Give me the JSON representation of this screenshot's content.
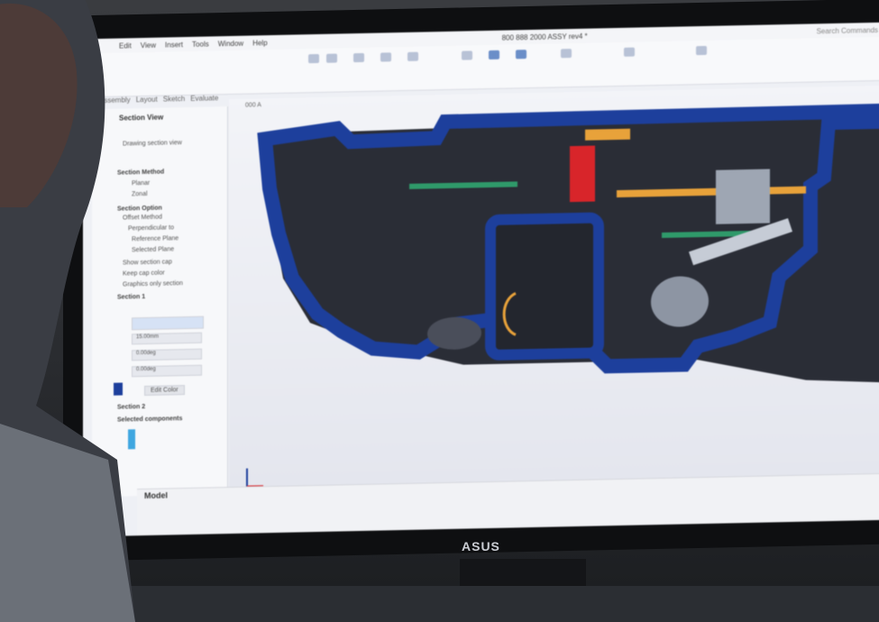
{
  "cad": {
    "menu": [
      "Edit",
      "View",
      "Insert",
      "Tools",
      "Window",
      "Help"
    ],
    "doc_title": "800 888 2000 ASSY rev4 *",
    "search_placeholder": "Search Commands",
    "left_tabs": [
      "Assembly",
      "Layout",
      "Sketch",
      "Evaluate"
    ],
    "viewport_label": "000 A",
    "panel": {
      "title": "Section View",
      "drawing_section_view": "Drawing section view",
      "section_method": "Section Method",
      "methods": [
        "Planar",
        "Zonal"
      ],
      "section_option": "Section Option",
      "offset_method": "Offset Method",
      "perpendicular_to": "Perpendicular to",
      "reference_plane": "Reference Plane",
      "selected_plane": "Selected Plane",
      "show_section_cap": "Show section cap",
      "keep_cap_color": "Keep cap color",
      "graphics_only_section": "Graphics only section",
      "section_1": "Section 1",
      "offset_value": "15.00mm",
      "angle_1": "0.00deg",
      "angle_2": "0.00deg",
      "edit_color": "Edit Color",
      "section_2": "Section 2",
      "selected_components": "Selected components"
    },
    "model_tab": "Model"
  },
  "monitor": {
    "brand": "ASUS"
  },
  "colors": {
    "section_blue": "#1d3f9c",
    "accent_orange": "#e8a23a",
    "accent_red": "#d8252a",
    "accent_green": "#2f9a6a"
  }
}
